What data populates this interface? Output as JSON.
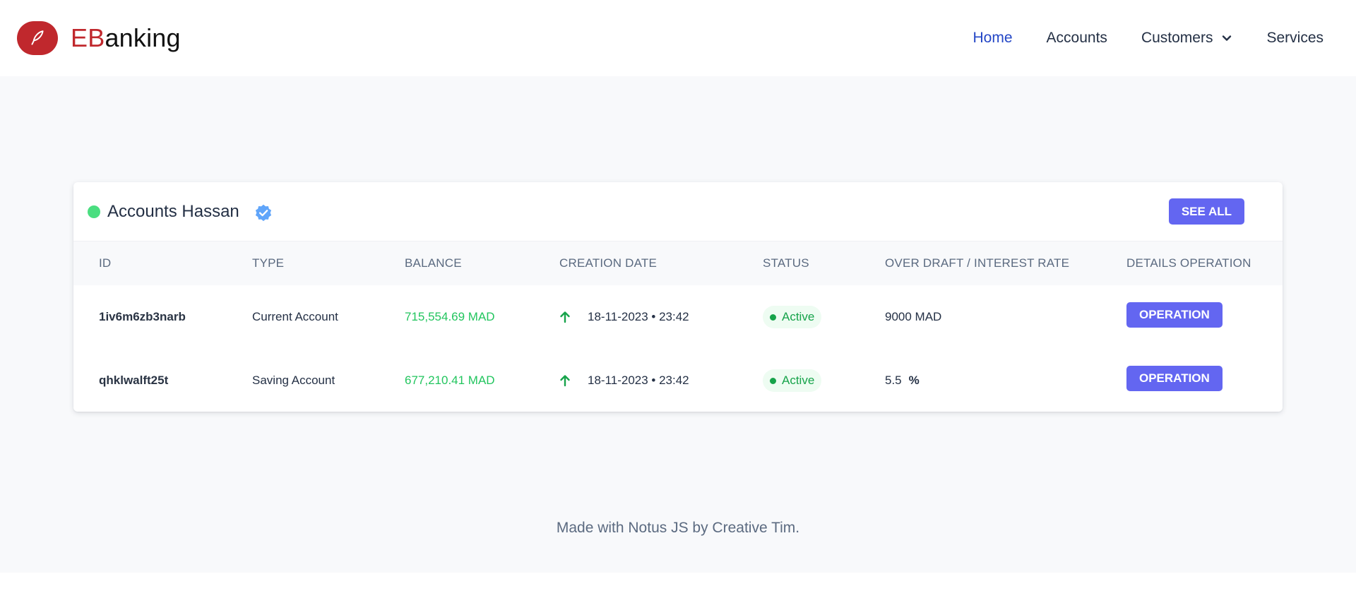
{
  "brand": {
    "accent": "EB",
    "rest": "anking",
    "logo_color": "#c0282d"
  },
  "nav": {
    "home": "Home",
    "accounts": "Accounts",
    "customers": "Customers",
    "services": "Services"
  },
  "card": {
    "title": "Accounts Hassan",
    "see_all": "SEE ALL",
    "columns": [
      "ID",
      "TYPE",
      "BALANCE",
      "CREATION DATE",
      "STATUS",
      "OVER DRAFT / INTEREST RATE",
      "DETAILS OPERATION"
    ],
    "rows": [
      {
        "id": "1iv6m6zb3narb",
        "type": "Current Account",
        "balance": "715,554.69 MAD",
        "date": "18-11-2023 • 23:42",
        "status": "Active",
        "overdraft": "9000 MAD",
        "unit": "",
        "action": "OPERATION"
      },
      {
        "id": "qhklwalft25t",
        "type": "Saving Account",
        "balance": "677,210.41 MAD",
        "date": "18-11-2023 • 23:42",
        "status": "Active",
        "overdraft": "5.5",
        "unit": "%",
        "action": "OPERATION"
      }
    ]
  },
  "footer": {
    "text": "Made with Notus JS by Creative Tim."
  },
  "colors": {
    "primary": "#6366f1",
    "nav_active": "#2346c6",
    "positive": "#22c55e",
    "status_active": "#16a34a",
    "online": "#4ade80"
  }
}
